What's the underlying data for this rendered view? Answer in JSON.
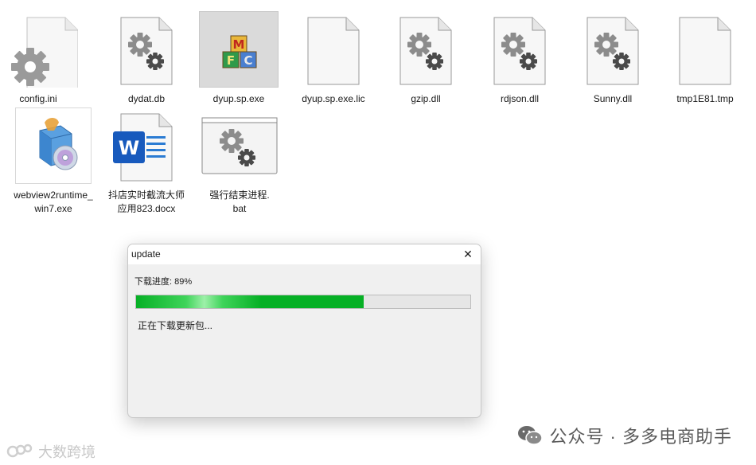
{
  "files": [
    {
      "name": "config.ini",
      "icon": "config-settings-icon"
    },
    {
      "name": "dydat.db",
      "icon": "gear-file-icon"
    },
    {
      "name": "dyup.sp.exe",
      "icon": "mfc-blocks-icon",
      "selected": true
    },
    {
      "name": "dyup.sp.exe.lic",
      "icon": "blank-file-icon"
    },
    {
      "name": "gzip.dll",
      "icon": "gear-file-icon"
    },
    {
      "name": "rdjson.dll",
      "icon": "gear-file-icon"
    },
    {
      "name": "Sunny.dll",
      "icon": "gear-file-icon"
    },
    {
      "name": "tmp1E81.tmp",
      "icon": "blank-file-icon"
    },
    {
      "name": "webview2runtime_win7.exe",
      "icon": "installer-box-icon"
    },
    {
      "name": "抖店实时截流大师应用823.docx",
      "icon": "word-document-icon"
    },
    {
      "name": "强行结束进程.bat",
      "icon": "batch-window-icon"
    }
  ],
  "dialog": {
    "title": "update",
    "progress_label": "下载进度: 89%",
    "progress_value": 0.68,
    "status_text": "正在下载更新包...",
    "close_symbol": "✕"
  },
  "watermarks": {
    "right": "公众号 · 多多电商助手",
    "left": "大数跨境"
  }
}
